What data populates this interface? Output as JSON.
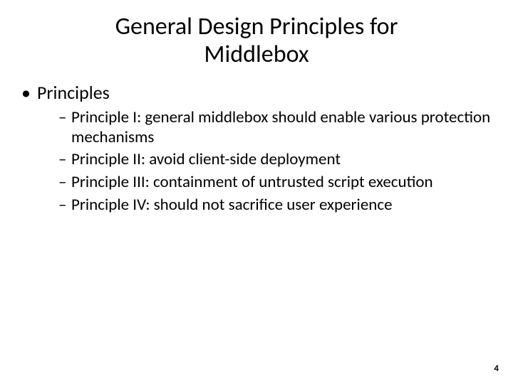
{
  "title_line1": "General Design Principles for",
  "title_line2": "Middlebox",
  "section": "Principles",
  "items": [
    {
      "label": "Principle I",
      "text": ": general middlebox should enable various protection mechanisms"
    },
    {
      "label": "Principle II",
      "text": ": avoid client-side deployment"
    },
    {
      "label": "Principle III",
      "text": ": containment of untrusted script execution"
    },
    {
      "label": "Principle IV",
      "text": ": should not sacrifice user experience"
    }
  ],
  "page_number": "4",
  "dash": "–"
}
